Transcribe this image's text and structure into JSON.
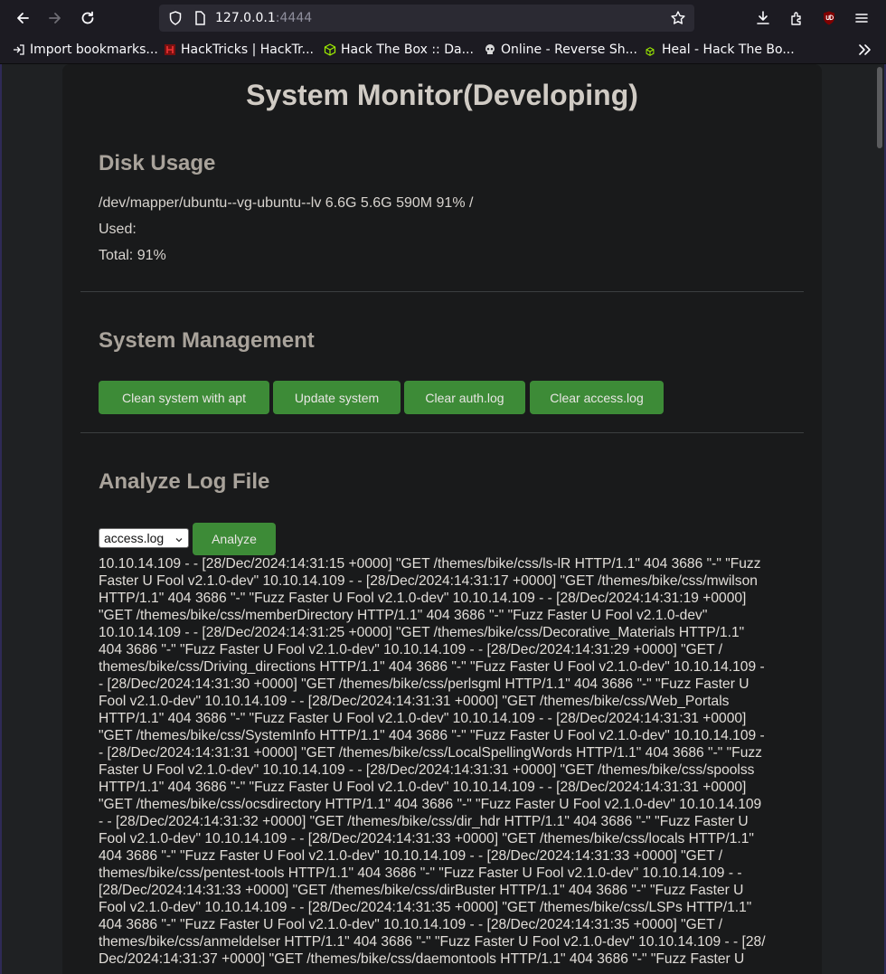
{
  "browser": {
    "url_host": "127.0.0.1",
    "url_port": ":4444",
    "bookmarks": [
      {
        "label": "Import bookmarks..."
      },
      {
        "label": "HackTricks | HackTr..."
      },
      {
        "label": "Hack The Box :: Da..."
      },
      {
        "label": "Online - Reverse Sh..."
      },
      {
        "label": "Heal - Hack The Bo..."
      }
    ]
  },
  "page": {
    "title": "System Monitor(Developing)",
    "disk": {
      "heading": "Disk Usage",
      "line": "/dev/mapper/ubuntu--vg-ubuntu--lv 6.6G 5.6G 590M 91% /",
      "used": "Used:",
      "total": "Total: 91%"
    },
    "management": {
      "heading": "System Management",
      "buttons": [
        {
          "label": "Clean system with apt"
        },
        {
          "label": "Update system"
        },
        {
          "label": "Clear auth.log"
        },
        {
          "label": "Clear access.log"
        }
      ]
    },
    "analyze": {
      "heading": "Analyze Log File",
      "select_value": "access.log",
      "button": "Analyze",
      "log_lines": [
        "10.10.14.109 - - [28/Dec/2024:14:31:15 +0000] \"GET /themes/bike/css/ls-lR HTTP/1.1\" 404 3686 \"-\" \"Fuzz",
        "Faster U Fool v2.1.0-dev\" 10.10.14.109 - - [28/Dec/2024:14:31:17 +0000] \"GET /themes/bike/css/mwilson",
        "HTTP/1.1\" 404 3686 \"-\" \"Fuzz Faster U Fool v2.1.0-dev\" 10.10.14.109 - - [28/Dec/2024:14:31:19 +0000]",
        "\"GET /themes/bike/css/memberDirectory HTTP/1.1\" 404 3686 \"-\" \"Fuzz Faster U Fool v2.1.0-dev\"",
        "10.10.14.109 - - [28/Dec/2024:14:31:25 +0000] \"GET /themes/bike/css/Decorative_Materials HTTP/1.1\"",
        "404 3686 \"-\" \"Fuzz Faster U Fool v2.1.0-dev\" 10.10.14.109 - - [28/Dec/2024:14:31:29 +0000] \"GET /",
        "themes/bike/css/Driving_directions HTTP/1.1\" 404 3686 \"-\" \"Fuzz Faster U Fool v2.1.0-dev\" 10.10.14.109 -",
        "- [28/Dec/2024:14:31:30 +0000] \"GET /themes/bike/css/perlsgml HTTP/1.1\" 404 3686 \"-\" \"Fuzz Faster U",
        "Fool v2.1.0-dev\" 10.10.14.109 - - [28/Dec/2024:14:31:31 +0000] \"GET /themes/bike/css/Web_Portals",
        "HTTP/1.1\" 404 3686 \"-\" \"Fuzz Faster U Fool v2.1.0-dev\" 10.10.14.109 - - [28/Dec/2024:14:31:31 +0000]",
        "\"GET /themes/bike/css/SystemInfo HTTP/1.1\" 404 3686 \"-\" \"Fuzz Faster U Fool v2.1.0-dev\" 10.10.14.109 -",
        "- [28/Dec/2024:14:31:31 +0000] \"GET /themes/bike/css/LocalSpellingWords HTTP/1.1\" 404 3686 \"-\" \"Fuzz",
        "Faster U Fool v2.1.0-dev\" 10.10.14.109 - - [28/Dec/2024:14:31:31 +0000] \"GET /themes/bike/css/spoolss",
        "HTTP/1.1\" 404 3686 \"-\" \"Fuzz Faster U Fool v2.1.0-dev\" 10.10.14.109 - - [28/Dec/2024:14:31:31 +0000]",
        "\"GET /themes/bike/css/ocsdirectory HTTP/1.1\" 404 3686 \"-\" \"Fuzz Faster U Fool v2.1.0-dev\" 10.10.14.109",
        "- - [28/Dec/2024:14:31:32 +0000] \"GET /themes/bike/css/dir_hdr HTTP/1.1\" 404 3686 \"-\" \"Fuzz Faster U",
        "Fool v2.1.0-dev\" 10.10.14.109 - - [28/Dec/2024:14:31:33 +0000] \"GET /themes/bike/css/locals HTTP/1.1\"",
        "404 3686 \"-\" \"Fuzz Faster U Fool v2.1.0-dev\" 10.10.14.109 - - [28/Dec/2024:14:31:33 +0000] \"GET /",
        "themes/bike/css/pentest-tools HTTP/1.1\" 404 3686 \"-\" \"Fuzz Faster U Fool v2.1.0-dev\" 10.10.14.109 - -",
        "[28/Dec/2024:14:31:33 +0000] \"GET /themes/bike/css/dirBuster HTTP/1.1\" 404 3686 \"-\" \"Fuzz Faster U",
        "Fool v2.1.0-dev\" 10.10.14.109 - - [28/Dec/2024:14:31:35 +0000] \"GET /themes/bike/css/LSPs HTTP/1.1\"",
        "404 3686 \"-\" \"Fuzz Faster U Fool v2.1.0-dev\" 10.10.14.109 - - [28/Dec/2024:14:31:35 +0000] \"GET /",
        "themes/bike/css/anmeldelser HTTP/1.1\" 404 3686 \"-\" \"Fuzz Faster U Fool v2.1.0-dev\" 10.10.14.109 - - [28/",
        "Dec/2024:14:31:37 +0000] \"GET /themes/bike/css/daemontools HTTP/1.1\" 404 3686 \"-\" \"Fuzz Faster U"
      ]
    }
  }
}
